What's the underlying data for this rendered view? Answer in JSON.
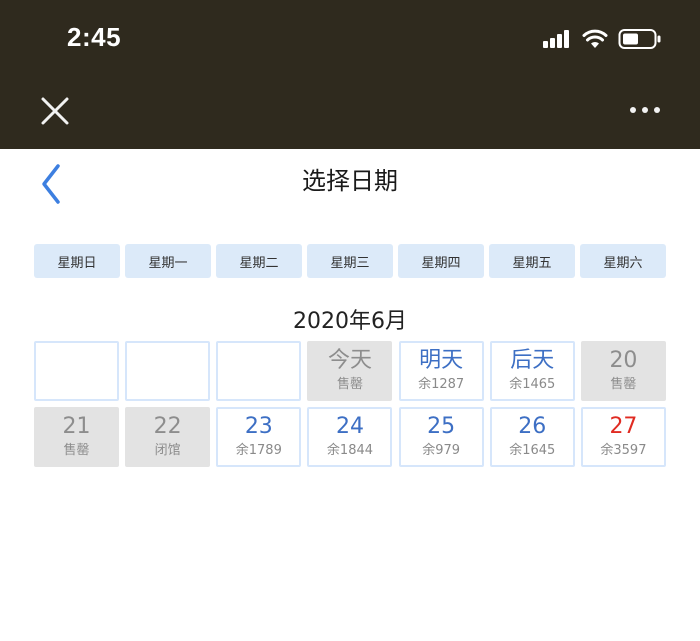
{
  "status_bar": {
    "time": "2:45"
  },
  "header": {
    "title": "选择日期"
  },
  "weekdays": [
    "星期日",
    "星期一",
    "星期二",
    "星期三",
    "星期四",
    "星期五",
    "星期六"
  ],
  "calendar": {
    "month_label": "2020年6月",
    "rows": [
      [
        {
          "big": "",
          "small": "",
          "state": "empty"
        },
        {
          "big": "",
          "small": "",
          "state": "empty"
        },
        {
          "big": "",
          "small": "",
          "state": "empty"
        },
        {
          "big": "今天",
          "small": "售罄",
          "state": "gray"
        },
        {
          "big": "明天",
          "small": "余1287",
          "state": "available"
        },
        {
          "big": "后天",
          "small": "余1465",
          "state": "available"
        },
        {
          "big": "20",
          "small": "售罄",
          "state": "gray"
        }
      ],
      [
        {
          "big": "21",
          "small": "售罄",
          "state": "gray"
        },
        {
          "big": "22",
          "small": "闭馆",
          "state": "gray"
        },
        {
          "big": "23",
          "small": "余1789",
          "state": "available"
        },
        {
          "big": "24",
          "small": "余1844",
          "state": "available"
        },
        {
          "big": "25",
          "small": "余979",
          "state": "available"
        },
        {
          "big": "26",
          "small": "余1645",
          "state": "available"
        },
        {
          "big": "27",
          "small": "余3597",
          "state": "red"
        }
      ]
    ]
  },
  "colors": {
    "accent": "#3d6fc4",
    "weekday_bg": "#dceaf9",
    "soldout_bg": "#e3e3e3",
    "weekend_red": "#e02b22",
    "topbar_bg": "#2f2a1e"
  },
  "icons": {
    "close": "close-icon",
    "more": "more-icon",
    "back": "back-chevron-icon",
    "signal": "signal-icon",
    "wifi": "wifi-icon",
    "battery": "battery-icon"
  }
}
